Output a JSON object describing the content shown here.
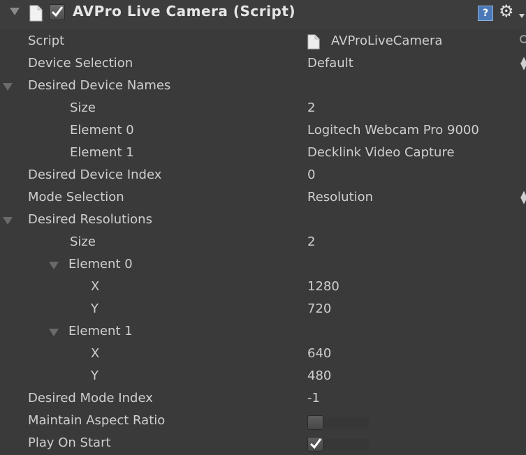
{
  "header": {
    "title": "AVPro Live Camera (Script)",
    "enabled": true,
    "help_icon": "?",
    "gear_icon": "⚙"
  },
  "rows": {
    "script": {
      "label": "Script",
      "value": "AVProLiveCamera"
    },
    "device_selection": {
      "label": "Device Selection",
      "value": "Default"
    },
    "desired_device_names": {
      "label": "Desired Device Names"
    },
    "names_size": {
      "label": "Size",
      "value": "2"
    },
    "names_element0": {
      "label": "Element 0",
      "value": "Logitech Webcam Pro 9000"
    },
    "names_element1": {
      "label": "Element 1",
      "value": "Decklink Video Capture"
    },
    "desired_device_index": {
      "label": "Desired Device Index",
      "value": "0"
    },
    "mode_selection": {
      "label": "Mode Selection",
      "value": "Resolution"
    },
    "desired_resolutions": {
      "label": "Desired Resolutions"
    },
    "res_size": {
      "label": "Size",
      "value": "2"
    },
    "res_element0": {
      "label": "Element 0"
    },
    "res0_x": {
      "label": "X",
      "value": "1280"
    },
    "res0_y": {
      "label": "Y",
      "value": "720"
    },
    "res_element1": {
      "label": "Element 1"
    },
    "res1_x": {
      "label": "X",
      "value": "640"
    },
    "res1_y": {
      "label": "Y",
      "value": "480"
    },
    "desired_mode_index": {
      "label": "Desired Mode Index",
      "value": "-1"
    },
    "maintain_aspect_ratio": {
      "label": "Maintain Aspect Ratio",
      "checked": false
    },
    "play_on_start": {
      "label": "Play On Start",
      "checked": true
    }
  },
  "colors": {
    "background": "#3a3a3a",
    "text": "#cfcfcf",
    "help_blue": "#4b79b8"
  }
}
